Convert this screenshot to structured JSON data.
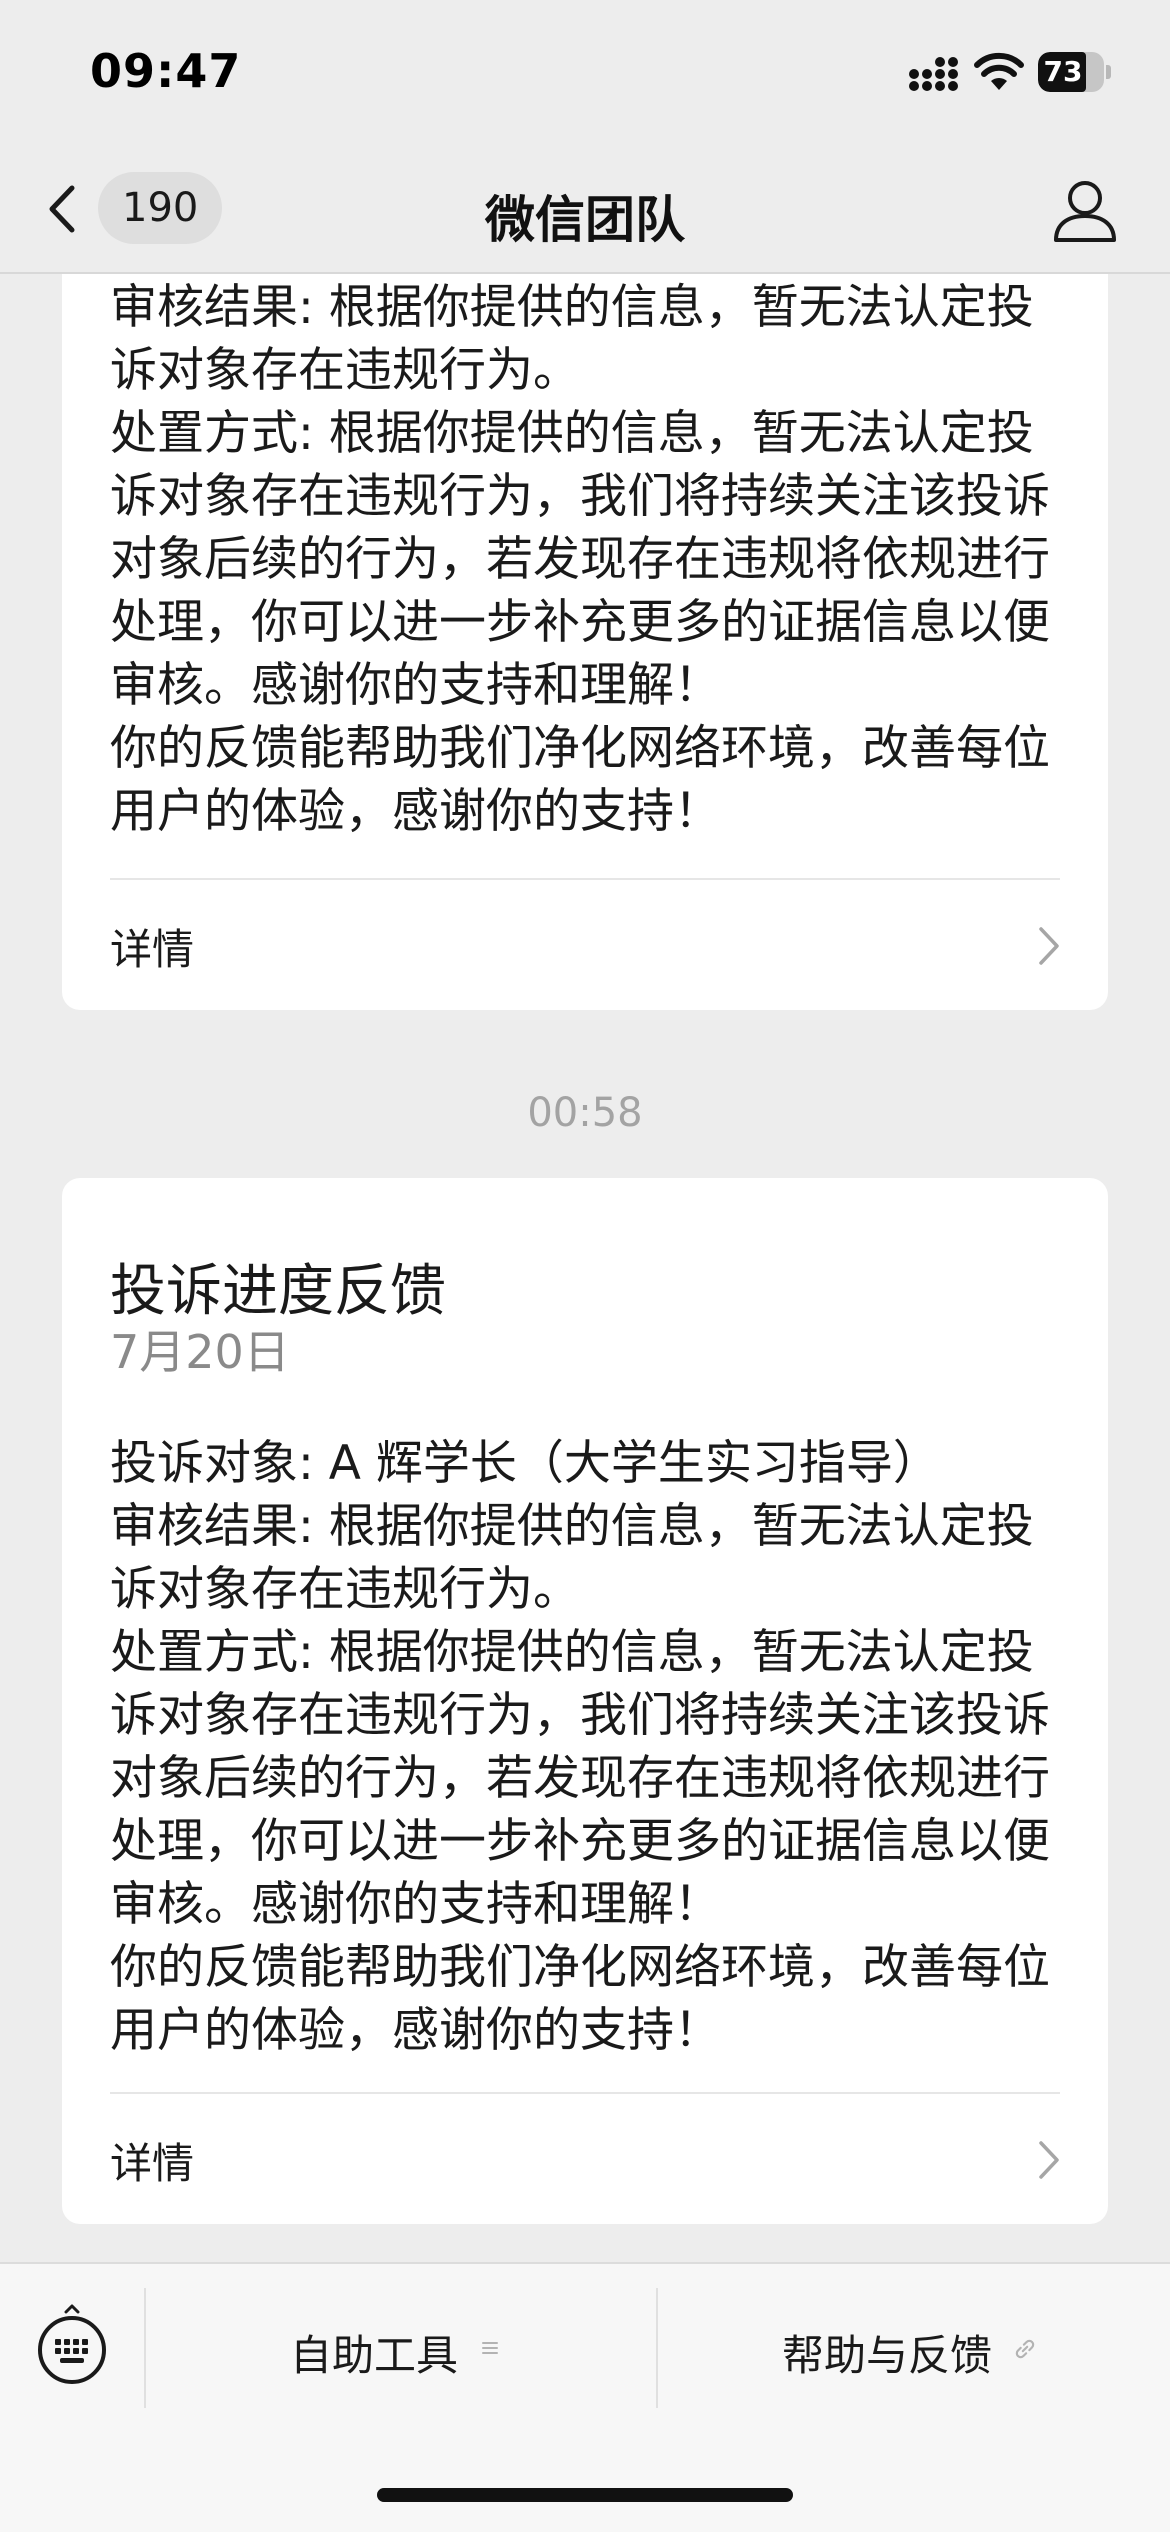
{
  "status_bar": {
    "time": "09:47",
    "battery_level": "73",
    "icons": [
      "signal-icon",
      "wifi-icon",
      "battery-icon"
    ]
  },
  "nav": {
    "unread_count": "190",
    "title": "微信团队",
    "back_icon": "chevron-left-icon",
    "profile_icon": "person-icon"
  },
  "messages": [
    {
      "partial": true,
      "lines": [
        "审核结果: 根据你提供的信息，暂无法认定投诉对象存在违规行为。",
        "处置方式: 根据你提供的信息，暂无法认定投诉对象存在违规行为，我们将持续关注该投诉对象后续的行为，若发现存在违规将依规进行处理，你可以进一步补充更多的证据信息以便审核。感谢你的支持和理解！",
        "你的反馈能帮助我们净化网络环境，改善每位用户的体验，感谢你的支持！"
      ],
      "details_label": "详情"
    },
    {
      "partial": false,
      "title": "投诉进度反馈",
      "date": "7月20日",
      "lines": [
        "投诉对象: A 辉学长（大学生实习指导）",
        "审核结果: 根据你提供的信息，暂无法认定投诉对象存在违规行为。",
        "处置方式: 根据你提供的信息，暂无法认定投诉对象存在违规行为，我们将持续关注该投诉对象后续的行为，若发现存在违规将依规进行处理，你可以进一步补充更多的证据信息以便审核。感谢你的支持和理解！",
        "你的反馈能帮助我们净化网络环境，改善每位用户的体验，感谢你的支持！"
      ],
      "details_label": "详情"
    }
  ],
  "timestamp": "00:58",
  "bottom_menu": {
    "keyboard_icon": "keyboard-icon",
    "items": [
      {
        "label": "自助工具",
        "icon": "menu-lines-icon"
      },
      {
        "label": "帮助与反馈",
        "icon": "link-icon"
      }
    ]
  },
  "colors": {
    "background": "#ededed",
    "card": "#ffffff",
    "secondary_text": "#8a8a8a",
    "timestamp_text": "#a3a3a3"
  }
}
